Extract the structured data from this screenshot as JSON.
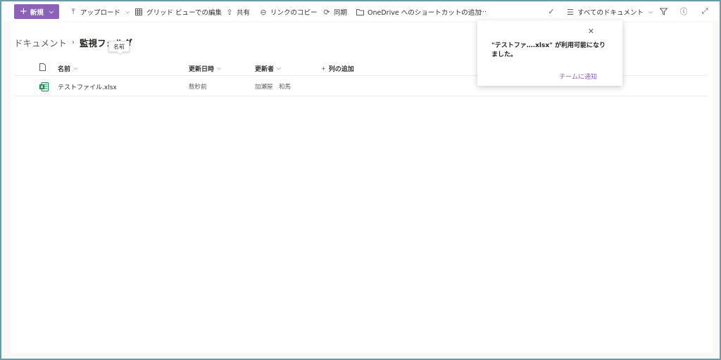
{
  "toolbar": {
    "new_label": "新規",
    "upload_label": "アップロード",
    "grid_edit_label": "グリッド ビューでの編集",
    "share_label": "共有",
    "copy_link_label": "リンクのコピー",
    "sync_label": "同期",
    "onedrive_label": "OneDrive へのショートカットの追加",
    "more_label": "···",
    "view_label": "すべてのドキュメント"
  },
  "breadcrumb": {
    "root": "ドキュメント",
    "current": "監視フォルダ"
  },
  "tooltip": "名前",
  "list": {
    "columns": {
      "name": "名前",
      "modified": "更新日時",
      "modified_by": "更新者",
      "add_column": "列の追加"
    },
    "rows": [
      {
        "name": "テストファイル.xlsx",
        "modified": "数秒前",
        "modified_by": "加瀬屋　和馬"
      }
    ]
  },
  "notification": {
    "message": "\"テストファ….xlsx\" が利用可能になりました。",
    "action": "チームに通知"
  },
  "colors": {
    "accent": "#8c62b9",
    "excel_green": "#1d7a45"
  }
}
